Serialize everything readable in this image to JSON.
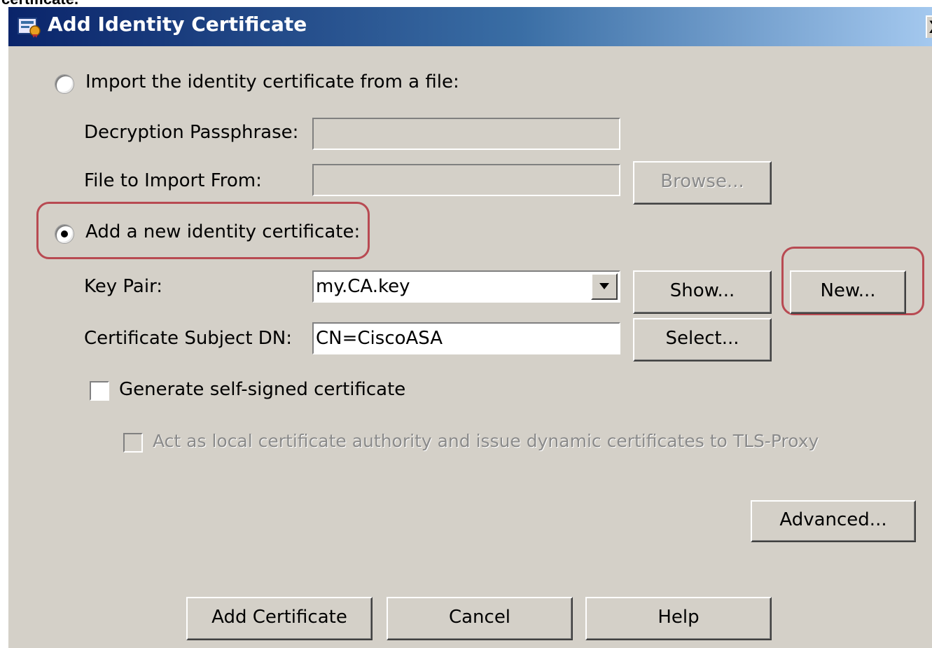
{
  "caption_fragment": "certificate.",
  "window": {
    "title": "Add Identity Certificate",
    "close_label": "X"
  },
  "import_section": {
    "radio_label": "Import the identity certificate from a file:",
    "selected": false,
    "passphrase_label": "Decryption Passphrase:",
    "passphrase_value": "",
    "file_label": "File to Import From:",
    "file_value": "",
    "browse_label": "Browse..."
  },
  "new_section": {
    "radio_label": "Add a new identity certificate:",
    "selected": true,
    "key_pair_label": "Key Pair:",
    "key_pair_value": "my.CA.key",
    "show_label": "Show...",
    "new_label": "New...",
    "subject_label": "Certificate Subject DN:",
    "subject_value": "CN=CiscoASA",
    "select_label": "Select...",
    "self_signed_label": "Generate self-signed certificate",
    "self_signed_checked": false,
    "local_ca_label": "Act as local certificate authority and issue dynamic certificates to TLS-Proxy",
    "local_ca_checked": false,
    "advanced_label": "Advanced..."
  },
  "footer": {
    "add_label": "Add Certificate",
    "cancel_label": "Cancel",
    "help_label": "Help"
  },
  "colors": {
    "dialog_bg": "#d4d0c8",
    "title_gradient_start": "#0a246a",
    "title_gradient_end": "#a6caf0",
    "highlight": "#b84a52"
  }
}
